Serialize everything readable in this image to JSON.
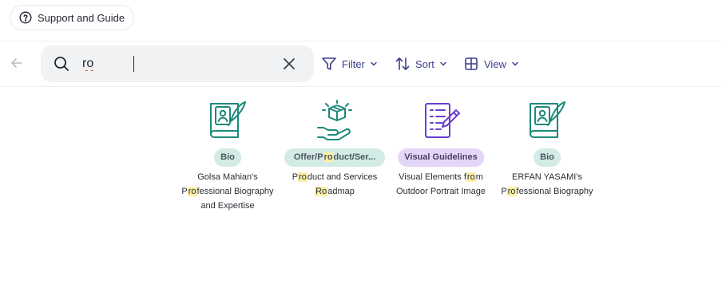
{
  "header": {
    "support_label": "Support and Guide"
  },
  "search": {
    "value": "ro",
    "placeholder": ""
  },
  "toolbar": {
    "filter_label": "Filter",
    "sort_label": "Sort",
    "view_label": "View"
  },
  "colors": {
    "accent": "#3b3f8f",
    "teal_icon": "#1d8a7a",
    "purple_icon": "#6b3fd1",
    "highlight": "#fbefa6",
    "tag_teal": "#d3ebe5",
    "tag_purple": "#e3d6f7"
  },
  "cards": [
    {
      "icon": "biography-book-pen-icon",
      "tag": "Bio",
      "title_parts": [
        "Golsa Mahian's",
        "P",
        "ro",
        "fessional Biography",
        "and Expertise"
      ]
    },
    {
      "icon": "product-box-hand-icon",
      "tag_parts": [
        "Offer/P",
        "ro",
        "duct/Ser..."
      ],
      "title_parts": [
        "P",
        "ro",
        "duct and Services",
        "Ro",
        "admap"
      ]
    },
    {
      "icon": "guidelines-checklist-pencil-icon",
      "tag": "Visual Guidelines",
      "title_parts": [
        "Visual Elements f",
        "ro",
        "m",
        "Outdoor Portrait Image"
      ]
    },
    {
      "icon": "biography-book-pen-icon",
      "tag": "Bio",
      "title_parts": [
        "ERFAN YASAMI's",
        "P",
        "ro",
        "fessional Biography"
      ]
    }
  ]
}
